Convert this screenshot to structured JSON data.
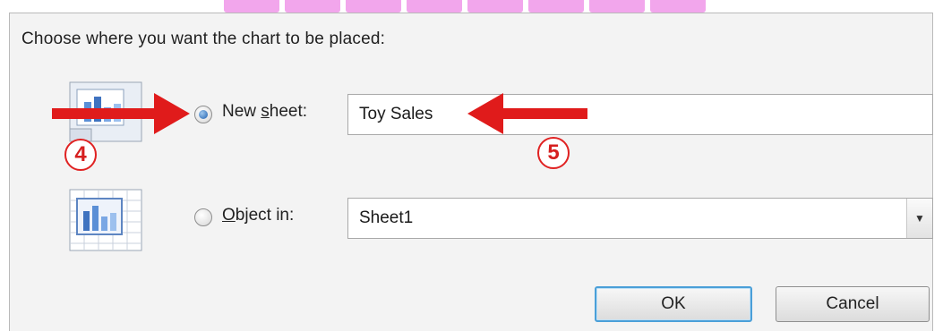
{
  "dialog": {
    "instruction": "Choose where you want the chart to be placed:",
    "options": [
      {
        "label_prefix": "New ",
        "label_accel": "s",
        "label_suffix": "heet:",
        "value": "Toy Sales",
        "selected": true
      },
      {
        "label_prefix": "",
        "label_accel": "O",
        "label_suffix": "bject in:",
        "value": "Sheet1",
        "selected": false
      }
    ],
    "buttons": {
      "ok": "OK",
      "cancel": "Cancel"
    }
  },
  "annotations": {
    "step_a": "4",
    "step_b": "5",
    "arrow_color": "#e01b1b"
  },
  "icons": {
    "new_sheet": "chart-sheet-icon",
    "object_in": "embedded-chart-icon",
    "dropdown": "chevron-down-icon"
  }
}
